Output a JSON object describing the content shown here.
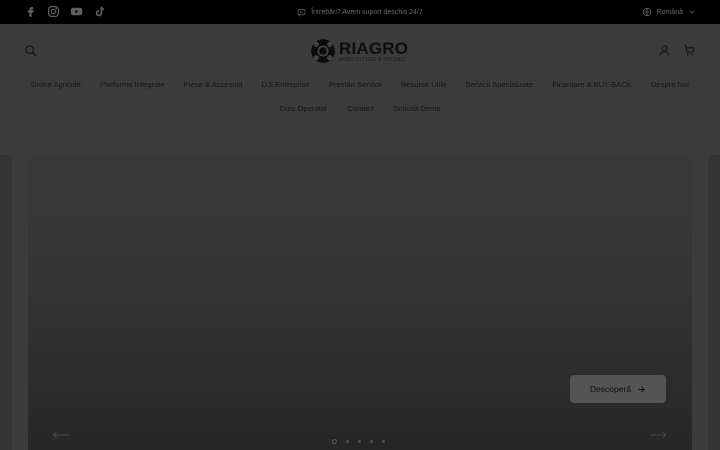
{
  "topbar": {
    "social_icons": [
      "facebook-icon",
      "instagram-icon",
      "youtube-icon",
      "tiktok-icon"
    ],
    "notice_text": "Întrebări? Avem suport deschis 24/7",
    "language": "Română"
  },
  "header": {
    "logo_title": "RIAGRO",
    "logo_subtitle": "AGRICULTURE & DRONES",
    "nav_primary": [
      "Drone Agricole",
      "Platforme Integrate",
      "Piese & Accesorii",
      "DJI Enterprise",
      "Prestări Servicii",
      "Resurse Utile",
      "Servicii Specializate",
      "Finanțare & BUY-BACK",
      "Despre Noi"
    ],
    "nav_secondary": [
      "Curs Operator",
      "Contact",
      "Solicită Demo"
    ]
  },
  "hero": {
    "cta_label": "Descoperă",
    "slide_count": 5,
    "active_slide": 1
  },
  "colors": {
    "topbar_bg": "#000000",
    "page_overlay": "#3c3c3c",
    "cta_bg": "#545454"
  }
}
